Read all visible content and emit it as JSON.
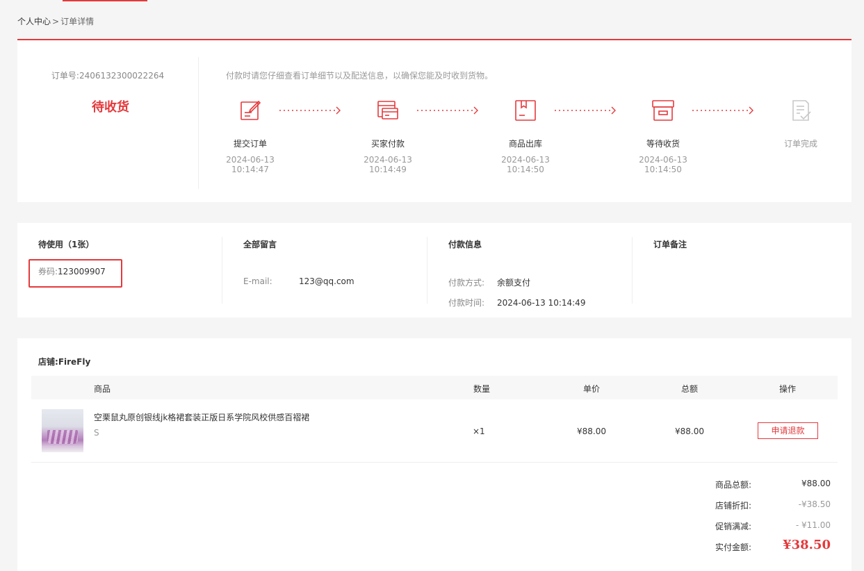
{
  "breadcrumb": {
    "home": "个人中心",
    "sep": ">",
    "current": "订单详情"
  },
  "order": {
    "number_label": "订单号:",
    "number": "2406132300022264",
    "status": "待收货",
    "tip": "付款时请您仔细查看订单细节以及配送信息，以确保您能及时收到货物。"
  },
  "steps": [
    {
      "name": "提交订单",
      "date": "2024-06-13",
      "time": "10:14:47",
      "icon": "edit-icon"
    },
    {
      "name": "买家付款",
      "date": "2024-06-13",
      "time": "10:14:49",
      "icon": "card-icon"
    },
    {
      "name": "商品出库",
      "date": "2024-06-13",
      "time": "10:14:50",
      "icon": "box-icon"
    },
    {
      "name": "等待收货",
      "date": "2024-06-13",
      "time": "10:14:50",
      "icon": "archive-icon"
    },
    {
      "name": "订单完成",
      "date": "",
      "time": "",
      "icon": "document-check-icon"
    }
  ],
  "info": {
    "coupon": {
      "title": "待使用（1张）",
      "label": "券码:",
      "code": "123009907"
    },
    "message": {
      "title": "全部留言",
      "label": "E-mail:",
      "value": "123@qq.com"
    },
    "payment": {
      "title": "付款信息",
      "method_label": "付款方式:",
      "method": "余额支付",
      "time_label": "付款时间:",
      "time": "2024-06-13 10:14:49"
    },
    "remark": {
      "title": "订单备注"
    }
  },
  "goods": {
    "shop_label": "店铺:",
    "shop_name": "FireFly",
    "headers": {
      "product": "商品",
      "qty": "数量",
      "price": "单价",
      "total": "总额",
      "action": "操作"
    },
    "items": [
      {
        "name": "空栗鼠丸原创银线jk格裙套装正版日系学院风校供感百褶裙",
        "spec": "S",
        "qty": "×1",
        "price": "¥88.00",
        "total": "¥88.00",
        "action": "申请退款"
      }
    ]
  },
  "summary": {
    "goods_total_label": "商品总额:",
    "goods_total": "¥88.00",
    "shop_discount_label": "店铺折扣:",
    "shop_discount": "-¥38.50",
    "promo_label": "促销满减:",
    "promo": "- ¥11.00",
    "paid_label": "实付金额:",
    "paid": "¥38.50"
  },
  "colors": {
    "accent": "#e4393c",
    "muted": "#999999",
    "pending_icon": "#c8c8c8"
  }
}
